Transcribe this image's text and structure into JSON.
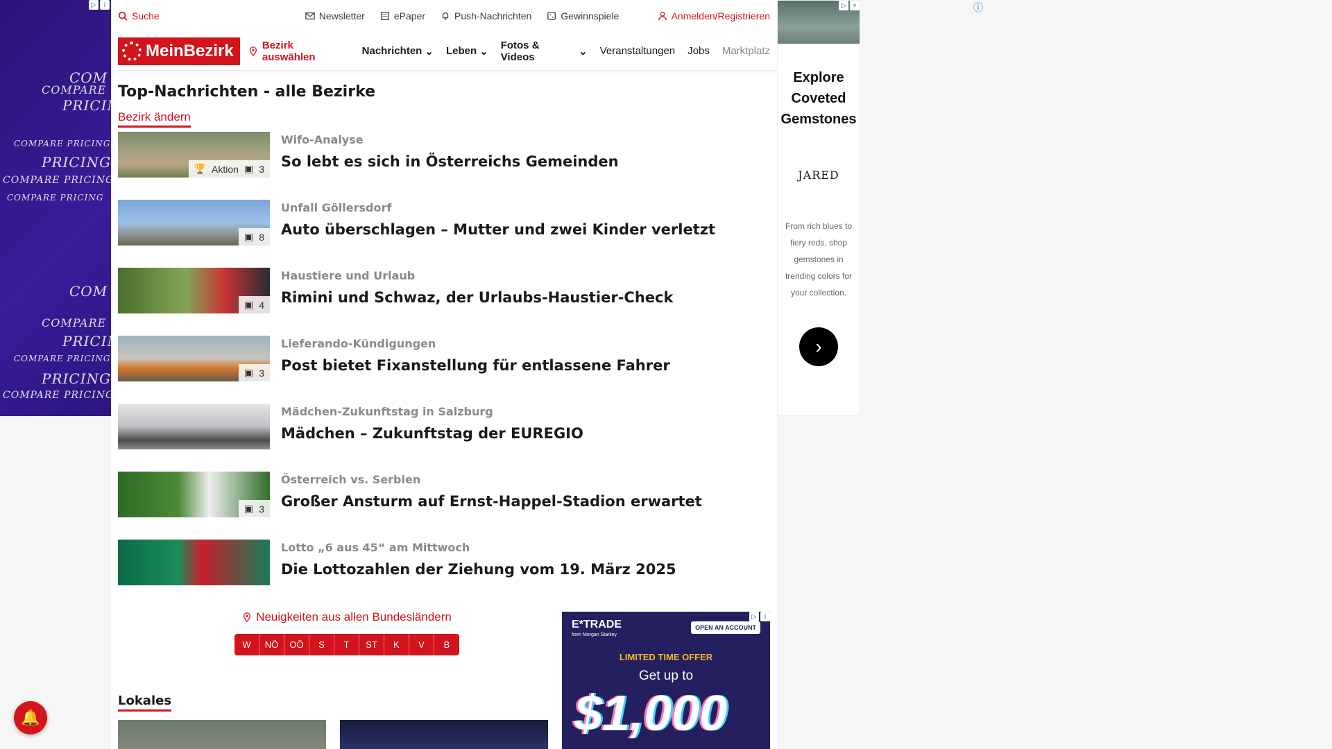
{
  "utility": {
    "search": "Suche",
    "newsletter": "Newsletter",
    "epaper": "ePaper",
    "push": "Push-Nachrichten",
    "gewinnspiele": "Gewinnspiele",
    "login": "Anmelden/Registrieren"
  },
  "nav": {
    "logo": "MeinBezirk",
    "district": "Bezirk auswählen",
    "items": [
      "Nachrichten",
      "Leben",
      "Fotos & Videos",
      "Veranstaltungen",
      "Jobs",
      "Marktplatz"
    ]
  },
  "main": {
    "title": "Top-Nachrichten - alle Bezirke",
    "change_district": "Bezirk ändern",
    "articles": [
      {
        "kicker": "Wifo-Analyse",
        "headline": "So lebt es sich in Österreichs Gemeinden",
        "tag": "Aktion",
        "count": "3"
      },
      {
        "kicker": "Unfall Göllersdorf",
        "headline": "Auto überschlagen – Mutter und zwei Kinder verletzt",
        "count": "8"
      },
      {
        "kicker": "Haustiere und Urlaub",
        "headline": "Rimini und Schwaz, der Urlaubs-Haustier-Check",
        "count": "4"
      },
      {
        "kicker": "Lieferando-Kündigungen",
        "headline": "Post bietet Fixanstellung für entlassene Fahrer",
        "count": "3"
      },
      {
        "kicker": "Mädchen-Zukunftstag in Salzburg",
        "headline": "Mädchen – Zukunftstag der EUREGIO"
      },
      {
        "kicker": "Österreich vs. Serbien",
        "headline": "Großer Ansturm auf Ernst-Happel-Stadion erwartet",
        "count": "3"
      },
      {
        "kicker": "Lotto „6 aus 45“ am Mittwoch",
        "headline": "Die Lottozahlen der Ziehung vom 19. März 2025"
      }
    ],
    "states_label": "Neuigkeiten aus allen Bundesländern",
    "states": [
      "W",
      "NÖ",
      "OÖ",
      "S",
      "T",
      "ST",
      "K",
      "V",
      "B"
    ],
    "lokales": "Lokales"
  },
  "left_ad": {
    "lines": [
      "COM",
      "COMPARE",
      "PRICIN",
      "COMPARE PRICING",
      "PRICING",
      "COMPARE PRICING",
      "COMPARE PRICING"
    ]
  },
  "etrade": {
    "brand": "E*TRADE",
    "sub": "from Morgan Stanley",
    "open": "OPEN AN ACCOUNT",
    "offer": "LIMITED TIME OFFER",
    "getup": "Get up to",
    "amount": "$1,000"
  },
  "right_ad": {
    "headline": "Explore Coveted Gemstones",
    "brand": "JARED",
    "body": "From rich blues to fiery reds, shop gemstones in trending colors for your collection.",
    "arrow": "›"
  },
  "colors": {
    "accent": "#d4141c",
    "ad_purple": "#2b1477"
  }
}
